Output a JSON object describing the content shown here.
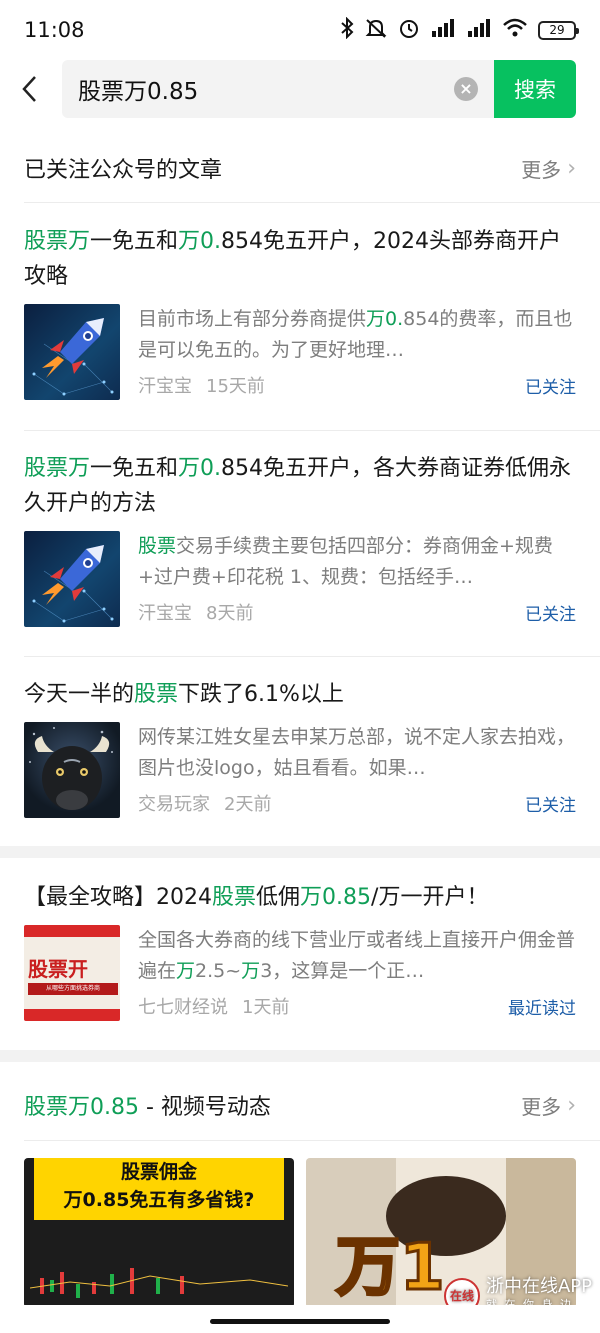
{
  "status": {
    "time": "11:08",
    "battery": "29",
    "icons": [
      "bluetooth-icon",
      "mute-icon",
      "alarm-icon",
      "signal-hd-icon",
      "signal-hd-icon",
      "wifi-icon",
      "battery-icon"
    ]
  },
  "search": {
    "query": "股票万0.85",
    "button_label": "搜索"
  },
  "section_articles": {
    "title": "已关注公众号的文章",
    "more": "更多"
  },
  "articles": [
    {
      "title_parts": [
        {
          "text": "股票万",
          "hl": true
        },
        {
          "text": "一免五和",
          "hl": false
        },
        {
          "text": "万0.",
          "hl": true
        },
        {
          "text": "854免五开户，2024头部券商开户攻略",
          "hl": false
        }
      ],
      "snippet_parts": [
        {
          "text": "目前市场上有部分券商提供",
          "hl": false
        },
        {
          "text": "万0.",
          "hl": true
        },
        {
          "text": "854的费率，而且也是可以免五的。为了更好地理…",
          "hl": false
        }
      ],
      "source": "汗宝宝",
      "time": "15天前",
      "tag": "已关注"
    },
    {
      "title_parts": [
        {
          "text": "股票万",
          "hl": true
        },
        {
          "text": "一免五和",
          "hl": false
        },
        {
          "text": "万0.",
          "hl": true
        },
        {
          "text": "854免五开户，各大券商证券低佣永久开户的方法",
          "hl": false
        }
      ],
      "snippet_parts": [
        {
          "text": "股票",
          "hl": true
        },
        {
          "text": "交易手续费主要包括四部分：券商佣金+规费+过户费+印花税 1、规费：包括经手…",
          "hl": false
        }
      ],
      "source": "汗宝宝",
      "time": "8天前",
      "tag": "已关注"
    },
    {
      "title_parts": [
        {
          "text": "今天一半的",
          "hl": false
        },
        {
          "text": "股票",
          "hl": true
        },
        {
          "text": "下跌了6.1%以上",
          "hl": false
        }
      ],
      "snippet_parts": [
        {
          "text": "网传某江姓女星去申某万总部，说不定人家去拍戏，图片也没logo，姑且看看。如果…",
          "hl": false
        }
      ],
      "source": "交易玩家",
      "time": "2天前",
      "tag": "已关注"
    },
    {
      "title_parts": [
        {
          "text": "【最全攻略】2024",
          "hl": false
        },
        {
          "text": "股票",
          "hl": true
        },
        {
          "text": "低佣",
          "hl": false
        },
        {
          "text": "万0.85",
          "hl": true
        },
        {
          "text": "/万一开户！",
          "hl": false
        }
      ],
      "snippet_parts": [
        {
          "text": "全国各大券商的线下营业厅或者线上直接开户佣金普遍在",
          "hl": false
        },
        {
          "text": "万",
          "hl": true
        },
        {
          "text": "2.5~",
          "hl": false
        },
        {
          "text": "万",
          "hl": true
        },
        {
          "text": "3，这算是一个正…",
          "hl": false
        }
      ],
      "source": "七七财经说",
      "time": "1天前",
      "tag": "最近读过",
      "thumb_text": "股票开",
      "thumb_sub": "从哪些方面挑选券商"
    }
  ],
  "section_video": {
    "title_hl": "股票万0.85",
    "title_rest": " - 视频号动态",
    "more": "更多"
  },
  "videos": [
    {
      "caption_line1": "股票佣金",
      "caption_line2": "万0.85免五有多省钱?"
    },
    {
      "caption": "万1"
    }
  ],
  "watermark": {
    "text": "浙中在线APP",
    "sub": "就 在 你 身 边",
    "logo": "在线"
  },
  "colors": {
    "brand_green": "#07c160",
    "highlight_green": "#0f9e57",
    "link_blue": "#1e5ea8"
  }
}
